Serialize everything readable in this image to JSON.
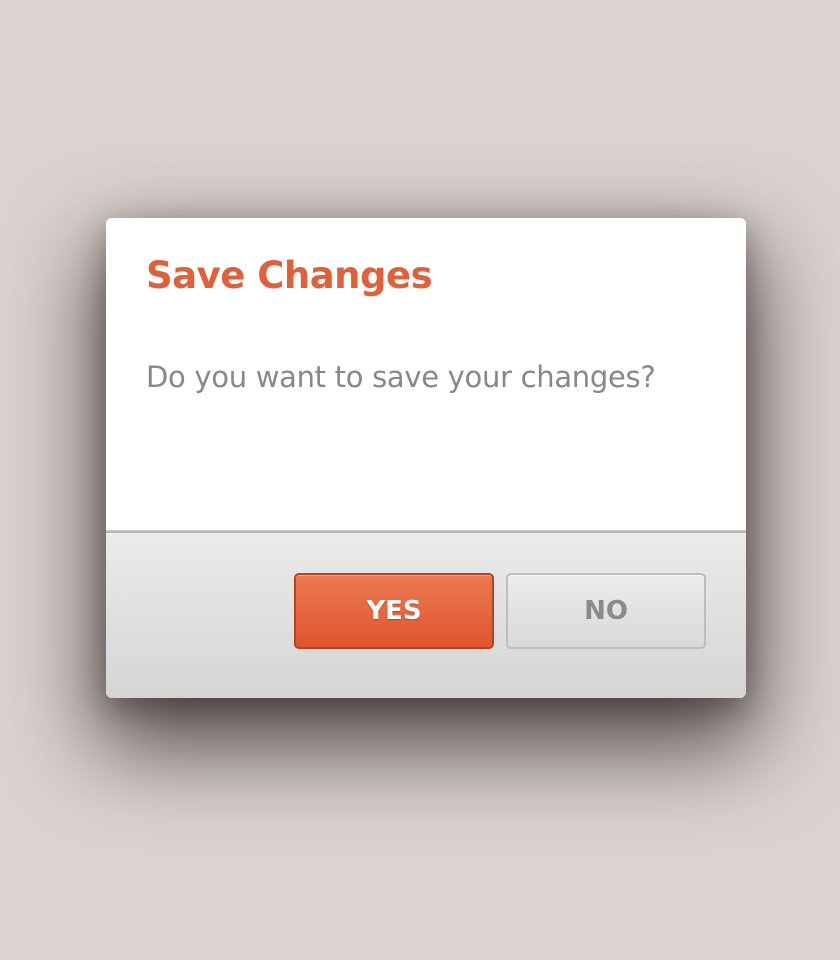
{
  "dialog": {
    "title": "Save Changes",
    "message": "Do you want to save your changes?",
    "buttons": {
      "yes_label": "YES",
      "no_label": "NO"
    }
  },
  "colors": {
    "accent": "#e0603a",
    "background": "#dad3d0",
    "message_text": "#8a8785",
    "secondary_button_text": "#8a8a8a"
  }
}
